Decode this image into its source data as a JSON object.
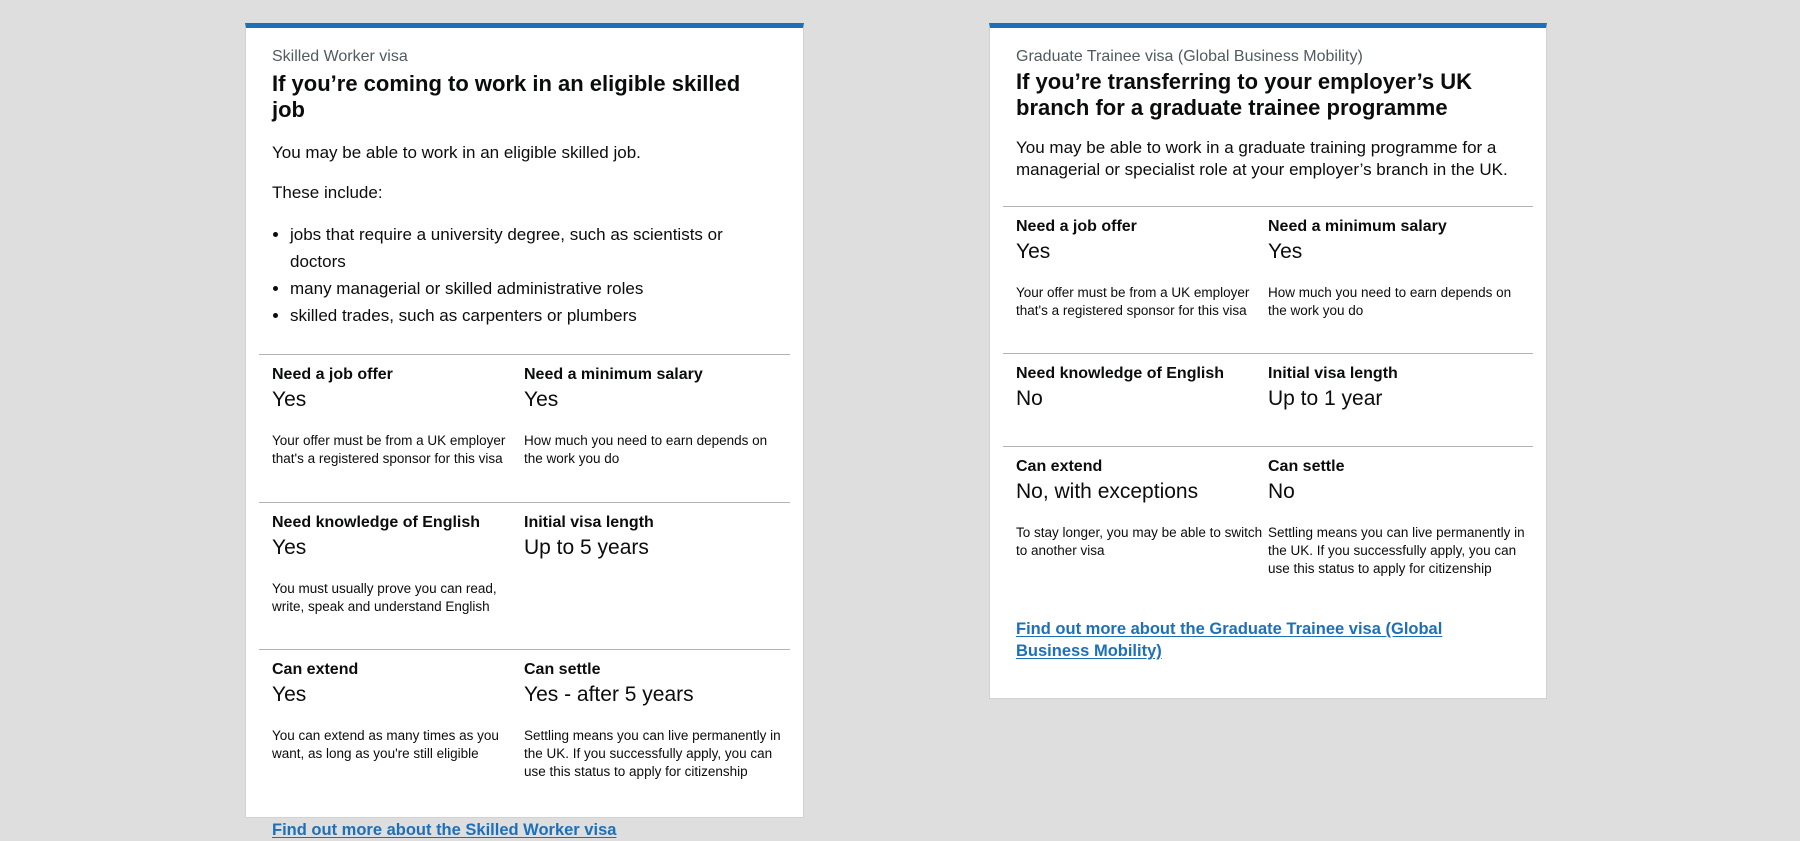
{
  "cards": [
    {
      "caption": "Skilled Worker visa",
      "heading": "If you’re coming to work in an eligible skilled job",
      "intro": "You may be able to work in an eligible skilled job.",
      "list_intro": "These include:",
      "list": [
        "jobs that require a university degree, such as scientists or doctors",
        "many managerial or skilled administrative roles",
        "skilled trades, such as carpenters or plumbers"
      ],
      "rows": [
        [
          {
            "label": "Need a job offer",
            "value": "Yes",
            "note": "Your offer must be from a UK employer that's a registered sponsor for this visa"
          },
          {
            "label": "Need a minimum salary",
            "value": "Yes",
            "note": "How much you need to earn depends on the work you do"
          }
        ],
        [
          {
            "label": "Need knowledge of English",
            "value": "Yes",
            "note": "You must usually prove you can read, write, speak and understand English"
          },
          {
            "label": "Initial visa length",
            "value": "Up to 5 years",
            "note": ""
          }
        ],
        [
          {
            "label": "Can extend",
            "value": "Yes",
            "note": "You can extend as many times as you want, as long as you're still eligible"
          },
          {
            "label": "Can settle",
            "value": "Yes - after 5 years",
            "note": "Settling means you can live permanently in the UK. If you successfully apply, you can use this status to apply for citizenship"
          }
        ]
      ],
      "link": "Find out more about the Skilled Worker visa"
    },
    {
      "caption": "Graduate Trainee visa (Global Business Mobility)",
      "heading": "If you’re transferring to your employer’s UK branch for a graduate trainee programme",
      "intro": "You may be able to work in a graduate training programme for a managerial or specialist role at your employer’s branch in the UK.",
      "rows": [
        [
          {
            "label": "Need a job offer",
            "value": "Yes",
            "note": "Your offer must be from a UK employer that's a registered sponsor for this visa"
          },
          {
            "label": "Need a minimum salary",
            "value": "Yes",
            "note": "How much you need to earn depends on the work you do"
          }
        ],
        [
          {
            "label": "Need knowledge of English",
            "value": "No",
            "note": ""
          },
          {
            "label": "Initial visa length",
            "value": "Up to 1 year",
            "note": ""
          }
        ],
        [
          {
            "label": "Can extend",
            "value": "No, with exceptions",
            "note": "To stay longer, you may be able to switch to another visa"
          },
          {
            "label": "Can settle",
            "value": "No",
            "note": "Settling means you can live permanently in the UK. If you successfully apply, you can use this status to apply for citizenship"
          }
        ]
      ],
      "link": "Find out more about the Graduate Trainee visa (Global Business Mobility)"
    }
  ],
  "colors": {
    "accent": "#1d70b8",
    "background": "#dedede",
    "text": "#0b0c0c",
    "caption": "#505a5f"
  }
}
